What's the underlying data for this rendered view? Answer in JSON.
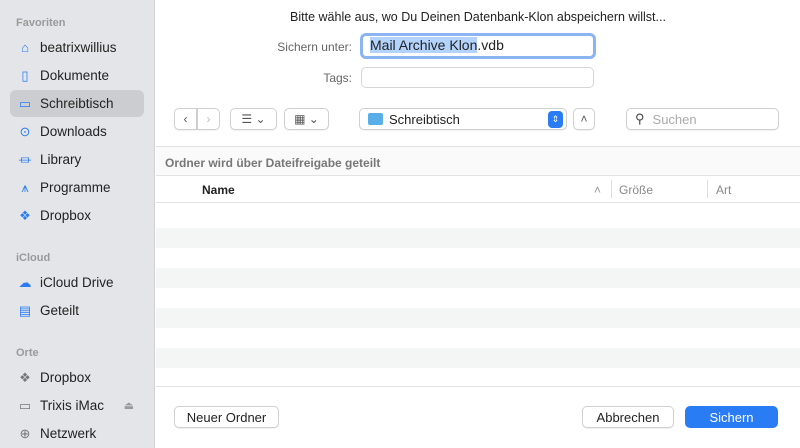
{
  "sidebar": {
    "sections": [
      {
        "label": "Favoriten",
        "items": [
          {
            "label": "beatrixwillius",
            "icon": "home-icon"
          },
          {
            "label": "Dokumente",
            "icon": "document-icon"
          },
          {
            "label": "Schreibtisch",
            "icon": "desktop-icon",
            "selected": true
          },
          {
            "label": "Downloads",
            "icon": "download-icon"
          },
          {
            "label": "Library",
            "icon": "library-icon"
          },
          {
            "label": "Programme",
            "icon": "applications-icon"
          },
          {
            "label": "Dropbox",
            "icon": "dropbox-icon"
          }
        ]
      },
      {
        "label": "iCloud",
        "items": [
          {
            "label": "iCloud Drive",
            "icon": "cloud-icon"
          },
          {
            "label": "Geteilt",
            "icon": "shared-folder-icon"
          }
        ]
      },
      {
        "label": "Orte",
        "items": [
          {
            "label": "Dropbox",
            "icon": "dropbox-icon"
          },
          {
            "label": "Trixis iMac",
            "icon": "imac-icon"
          },
          {
            "label": "Netzwerk",
            "icon": "network-icon"
          }
        ]
      }
    ]
  },
  "dialog": {
    "title": "Bitte wähle aus, wo Du Deinen Datenbank-Klon abspeichern willst...",
    "save_as_label": "Sichern unter:",
    "filename_selected": "Mail Archive Klon",
    "filename_ext": ".vdb",
    "tags_label": "Tags:",
    "location": "Schreibtisch",
    "search_placeholder": "Suchen",
    "shared_notice": "Ordner wird über Dateifreigabe geteilt",
    "columns": {
      "name": "Name",
      "size": "Größe",
      "kind": "Art"
    },
    "new_folder": "Neuer Ordner",
    "cancel": "Abbrechen",
    "save": "Sichern"
  },
  "colors": {
    "accent": "#2a7cf5",
    "sidebar": "#e3e5e8"
  }
}
